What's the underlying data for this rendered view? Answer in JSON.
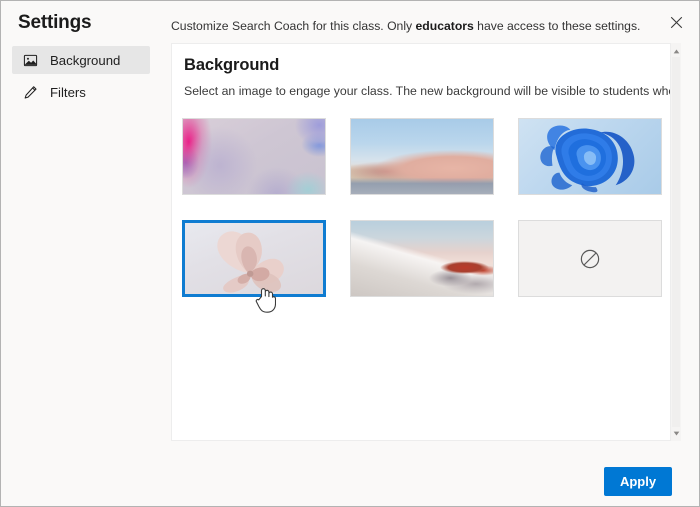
{
  "dialog": {
    "title": "Settings",
    "header_text_before": "Customize Search Coach for this class. Only ",
    "header_text_bold": "educators",
    "header_text_after": " have access to these settings.",
    "close_label": "✕"
  },
  "sidebar": {
    "items": [
      {
        "label": "Background",
        "icon": "image-icon",
        "selected": true
      },
      {
        "label": "Filters",
        "icon": "pencil-icon",
        "selected": false
      }
    ]
  },
  "main": {
    "section_title": "Background",
    "section_description": "Select an image to engage your class. The new background will be visible to students when they refresh.",
    "thumbnails": [
      {
        "name": "abstract-bubbles",
        "selected": false
      },
      {
        "name": "desert-dunes",
        "selected": false
      },
      {
        "name": "windows-bloom",
        "selected": false
      },
      {
        "name": "pink-flower",
        "selected": true
      },
      {
        "name": "white-sands",
        "selected": false
      },
      {
        "name": "no-background",
        "selected": false
      }
    ]
  },
  "footer": {
    "apply_label": "Apply"
  },
  "colors": {
    "accent": "#0078d4",
    "selection_border": "#0f7cd1",
    "dialog_background": "#faf9f8",
    "panel_background": "#ffffff"
  },
  "scrollbar": {
    "up_arrow": "▲",
    "down_arrow": "▼"
  }
}
